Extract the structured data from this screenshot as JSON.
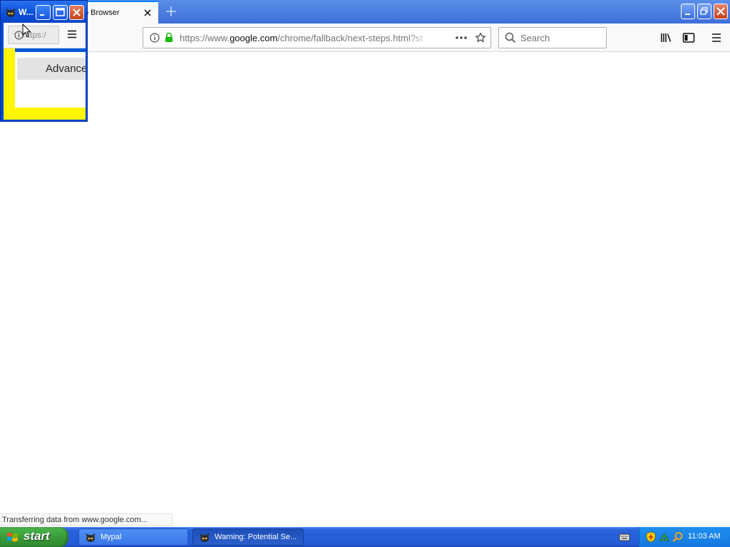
{
  "browser": {
    "tab_title": "o Browser",
    "url_scheme": "https://www.",
    "url_host": "google.com",
    "url_path": "/chrome/fallback/next-steps.html?st",
    "search_placeholder": "Search",
    "status_text": "Transferring data from www.google.com..."
  },
  "popup": {
    "title": "W...",
    "url_text": "https:/",
    "advanced_label": "Advanced..."
  },
  "taskbar": {
    "start_label": "start",
    "tasks": [
      {
        "label": "Mypal",
        "icon": "mypal-icon"
      },
      {
        "label": "Warning: Potential Se...",
        "icon": "mypal-icon"
      }
    ],
    "clock": "11:03 AM"
  },
  "colors": {
    "taskbar_blue": "#245cd8",
    "start_green": "#3a9a3a",
    "popup_yellow": "#fff600",
    "popup_title_blue": "#0a4fd8",
    "lock_green": "#12bc00"
  }
}
